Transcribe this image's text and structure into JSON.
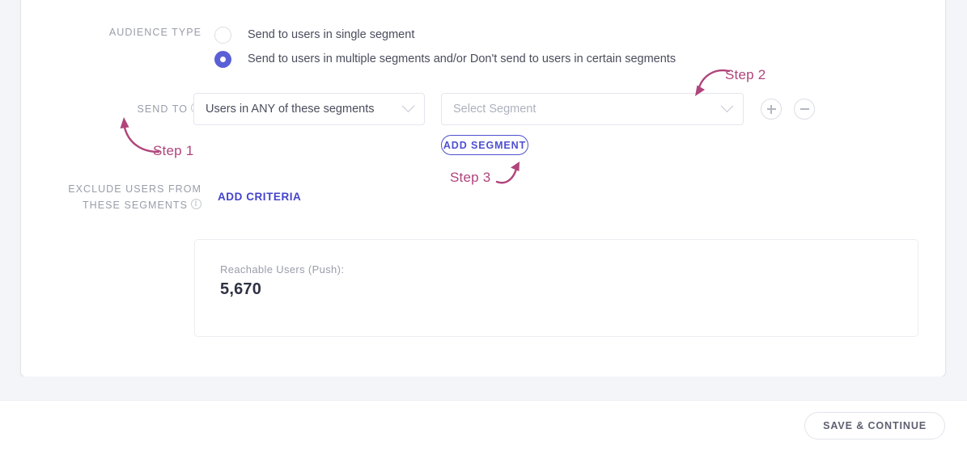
{
  "form": {
    "audience_type": {
      "label": "AUDIENCE TYPE",
      "options": [
        {
          "label": "Send to users in single segment",
          "selected": false
        },
        {
          "label": "Send to users in multiple segments and/or Don't send to users in certain segments",
          "selected": true
        }
      ]
    },
    "send_to": {
      "label": "SEND TO",
      "match_select_value": "Users in ANY of these segments",
      "segment_select_placeholder": "Select Segment",
      "add_button_label": "ADD SEGMENT",
      "add_row_icon": "plus-icon",
      "remove_row_icon": "minus-icon",
      "info_icon": "info-icon"
    },
    "exclude": {
      "label_line1": "EXCLUDE USERS FROM",
      "label_line2": "THESE SEGMENTS",
      "add_criteria_label": "ADD CRITERIA",
      "info_icon": "info-icon"
    }
  },
  "reach_panel": {
    "label": "Reachable Users (Push):",
    "value": "5,670"
  },
  "footer": {
    "save_label": "SAVE & CONTINUE"
  },
  "annotations": [
    {
      "label": "Step 1"
    },
    {
      "label": "Step 2"
    },
    {
      "label": "Step 3"
    }
  ],
  "colors": {
    "accent": "#5b5fd6",
    "link": "#4343cc",
    "annotation": "#b0447b",
    "page_bg": "#f4f5f8"
  }
}
